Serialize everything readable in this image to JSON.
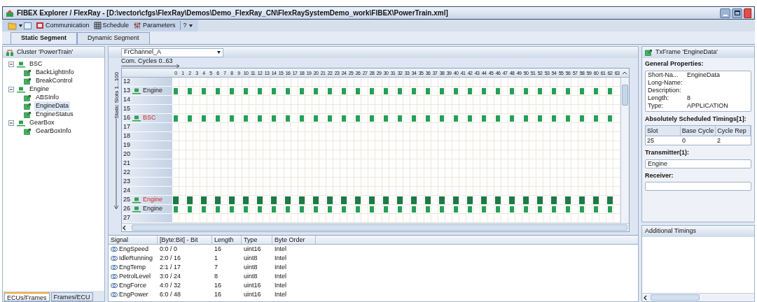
{
  "window": {
    "title": "FIBEX Explorer / FlexRay - [D:\\vector\\cfgs\\FlexRay\\Demos\\Demo_FlexRay_CN\\FlexRaySystemDemo_work\\FIBEX\\PowerTrain.xml]"
  },
  "toolbar": [
    {
      "kind": "open"
    },
    {
      "kind": "communication",
      "label": "Communication"
    },
    {
      "kind": "schedule",
      "label": "Schedule"
    },
    {
      "kind": "parameters",
      "label": "Parameters"
    },
    {
      "kind": "help",
      "label": "?"
    }
  ],
  "tabs": [
    {
      "label": "Static Segment",
      "selected": true
    },
    {
      "label": "Dynamic Segment",
      "selected": false
    }
  ],
  "cluster": {
    "title": "Cluster 'PowerTrain'",
    "tree": [
      {
        "label": "BSC",
        "kind": "ecu",
        "expanded": true,
        "selected": false,
        "children": [
          {
            "label": "BackLightInfo",
            "kind": "frame",
            "selected": false
          },
          {
            "label": "BreakControl",
            "kind": "frame",
            "selected": false
          }
        ]
      },
      {
        "label": "Engine",
        "kind": "ecu",
        "expanded": true,
        "selected": false,
        "children": [
          {
            "label": "ABSInfo",
            "kind": "frame",
            "selected": false
          },
          {
            "label": "EngineData",
            "kind": "frame",
            "selected": true
          },
          {
            "label": "EngineStatus",
            "kind": "frame",
            "selected": false
          }
        ]
      },
      {
        "label": "GearBox",
        "kind": "ecu",
        "expanded": true,
        "selected": false,
        "children": [
          {
            "label": "GearBoxInfo",
            "kind": "frame",
            "selected": false
          }
        ]
      }
    ],
    "bottom_tabs": [
      {
        "label": "ECUs/Frames",
        "selected": true
      },
      {
        "label": "Frames/ECU",
        "selected": false
      }
    ]
  },
  "schedule": {
    "channel": "FrChannel_A",
    "x_axis": "Com. Cycles 0..63",
    "y_axis": "Static Slots 1...100",
    "cycles": [
      "0",
      "1",
      "2",
      "3",
      "4",
      "5",
      "6",
      "7",
      "8",
      "9",
      "10",
      "11",
      "12",
      "13",
      "14",
      "15",
      "16",
      "17",
      "18",
      "19",
      "20",
      "21",
      "22",
      "23",
      "24",
      "25",
      "26",
      "27",
      "28",
      "29",
      "30",
      "31",
      "32",
      "33",
      "34",
      "35",
      "36",
      "37",
      "38",
      "39",
      "40",
      "41",
      "42",
      "43",
      "44",
      "45",
      "46",
      "47",
      "48",
      "49",
      "50",
      "51",
      "52",
      "53",
      "54",
      "55",
      "56",
      "57",
      "58",
      "59",
      "60",
      "61",
      "62",
      "63"
    ],
    "slots": [
      {
        "slot": "12"
      },
      {
        "slot": "13",
        "ecu": "Engine",
        "alert": false,
        "scheduled": true,
        "selected": false
      },
      {
        "slot": "14"
      },
      {
        "slot": "15"
      },
      {
        "slot": "16",
        "ecu": "BSC",
        "alert": true,
        "scheduled": true,
        "selected": false
      },
      {
        "slot": "17"
      },
      {
        "slot": "18"
      },
      {
        "slot": "19"
      },
      {
        "slot": "20"
      },
      {
        "slot": "21"
      },
      {
        "slot": "22"
      },
      {
        "slot": "23"
      },
      {
        "slot": "24"
      },
      {
        "slot": "25",
        "ecu": "Engine",
        "alert": true,
        "scheduled": true,
        "selected": true
      },
      {
        "slot": "26",
        "ecu": "Engine",
        "alert": false,
        "scheduled": true,
        "selected": false
      },
      {
        "slot": "27"
      }
    ]
  },
  "signals": {
    "columns": [
      "Signal",
      "[Byte:Bit] - Bit",
      "Length",
      "Type",
      "Byte Order"
    ],
    "rows": [
      [
        "EngSpeed",
        "0:0 / 0",
        "16",
        "uint16",
        "Intel"
      ],
      [
        "IdleRunning",
        "2:0 / 16",
        "1",
        "uint8",
        "Intel"
      ],
      [
        "EngTemp",
        "2:1 / 17",
        "7",
        "uint8",
        "Intel"
      ],
      [
        "PetrolLevel",
        "3:0 / 24",
        "8",
        "uint8",
        "Intel"
      ],
      [
        "EngForce",
        "4:0 / 32",
        "16",
        "uint16",
        "Intel"
      ],
      [
        "EngPower",
        "6:0 / 48",
        "16",
        "uint16",
        "Intel"
      ]
    ]
  },
  "properties": {
    "title": "TxFrame 'EngineData'",
    "general_heading": "General Properties:",
    "general": [
      {
        "label": "Short-Na...",
        "value": "EngineData"
      },
      {
        "label": "Long-Name:"
      },
      {
        "label": "Description:"
      },
      {
        "label": "Length:",
        "value": "8"
      },
      {
        "label": "Type:",
        "value": "APPLICATION"
      }
    ],
    "timings_heading": "Absolutely Scheduled Timings[1]:",
    "timings_columns": [
      "Slot",
      "Base Cycle",
      "Cycle Rep"
    ],
    "timings_rows": [
      [
        "25",
        "0",
        "2"
      ]
    ],
    "transmitter_heading": "Transmitter(1):",
    "transmitter": "Engine",
    "receiver_heading": "Receiver:",
    "additional_title": "Additional Timings"
  }
}
